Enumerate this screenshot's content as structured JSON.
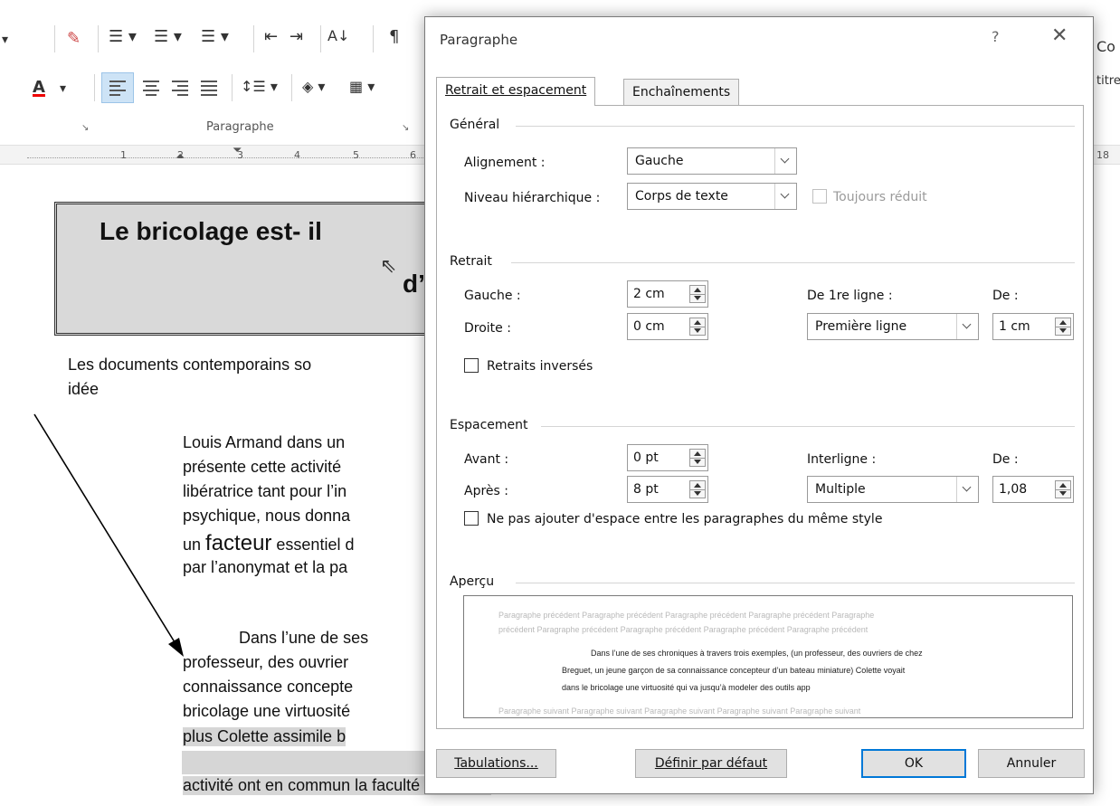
{
  "ribbon": {
    "group_label": "Paragraphe",
    "ruler_numbers": [
      "1",
      "2",
      "3",
      "4",
      "5",
      "6",
      "18"
    ],
    "right_fragments": [
      "Co",
      "titre"
    ]
  },
  "document": {
    "title_line1": "Le bricolage est- il",
    "title_line2": "d’",
    "intro_line1": "Les documents contemporains so",
    "intro_line2": "idée",
    "p1": [
      "Louis Armand dans un",
      "présente cette activité",
      "libératrice tant pour l’in",
      "psychique, nous donna",
      "un ",
      "facteur",
      " essentiel d",
      "par l’anonymat et la pa"
    ],
    "p2": [
      "Dans l’une de ses",
      "professeur, des ouvrier",
      "connaissance concepte",
      "bricolage une virtuosité",
      "plus Colette assimile b",
      "activité ont en commun la faculté créatrice."
    ]
  },
  "dialog": {
    "title": "Paragraphe",
    "help": "?",
    "close": "✕",
    "tabs": [
      "Retrait et espacement",
      "Enchaînements"
    ],
    "general": {
      "section": "Général",
      "alignment_label": "Alignement :",
      "alignment_value": "Gauche",
      "level_label": "Niveau hiérarchique :",
      "level_value": "Corps de texte",
      "collapsed_label": "Toujours réduit"
    },
    "indent": {
      "section": "Retrait",
      "left_label": "Gauche :",
      "left_value": "2 cm",
      "right_label": "Droite :",
      "right_value": "0 cm",
      "special_label": "De 1re ligne :",
      "special_value": "Première ligne",
      "by_label": "De :",
      "by_value": "1 cm",
      "mirror_label": "Retraits inversés"
    },
    "spacing": {
      "section": "Espacement",
      "before_label": "Avant :",
      "before_value": "0 pt",
      "after_label": "Après :",
      "after_value": "8 pt",
      "line_label": "Interligne :",
      "line_value": "Multiple",
      "at_label": "De :",
      "at_value": "1,08",
      "no_space_label": "Ne pas ajouter d'espace entre les paragraphes du même style"
    },
    "preview": {
      "section": "Aperçu",
      "prev_line1": "Paragraphe précédent Paragraphe précédent Paragraphe précédent Paragraphe précédent Paragraphe",
      "prev_line2": "précédent Paragraphe précédent Paragraphe précédent Paragraphe précédent Paragraphe précédent",
      "main_line1": "Dans l’une de ses chroniques à travers trois exemples, (un professeur, des ouvriers de chez",
      "main_line2": "Breguet, un jeune garçon de sa connaissance concepteur d’un bateau miniature) Colette voyait",
      "main_line3": "dans le bricolage une virtuosité qui va jusqu’à modeler des outils app",
      "next_line1": "Paragraphe suivant Paragraphe suivant Paragraphe suivant Paragraphe suivant Paragraphe suivant"
    },
    "buttons": {
      "tabs": "Tabulations...",
      "default": "Définir par défaut",
      "ok": "OK",
      "cancel": "Annuler"
    }
  }
}
